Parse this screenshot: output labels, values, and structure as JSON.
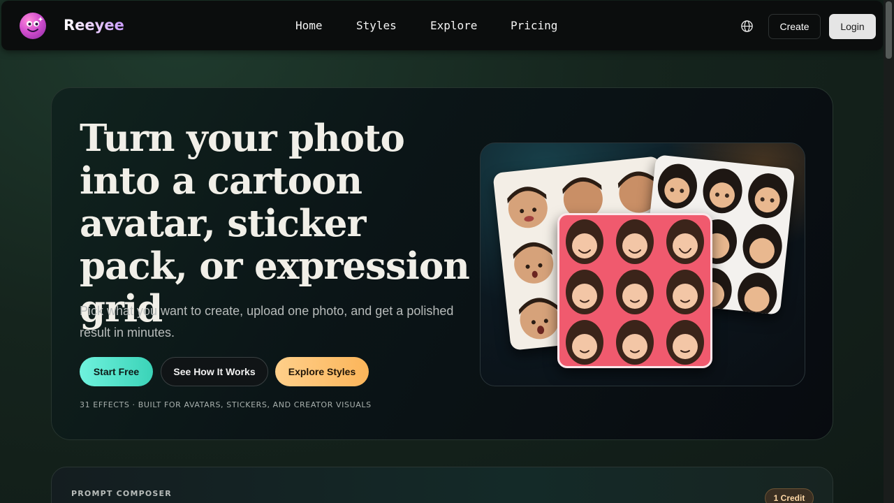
{
  "brand": {
    "name": "Reeyee"
  },
  "nav": {
    "links": [
      "Home",
      "Styles",
      "Explore",
      "Pricing"
    ],
    "create_label": "Create",
    "login_label": "Login"
  },
  "hero": {
    "title": "Turn your photo into a cartoon avatar, sticker pack, or expression grid",
    "subtitle": "Pick what you want to create, upload one photo, and get a polished result in minutes.",
    "buttons": {
      "start": "Start Free",
      "how": "See How It Works",
      "explore": "Explore Styles"
    },
    "meta": "31 EFFECTS · BUILT FOR AVATARS, STICKERS, AND CREATOR VISUALS"
  },
  "composer": {
    "label": "PROMPT COMPOSER",
    "credit": "1 Credit"
  },
  "colors": {
    "accent_teal": "#3bd3b8",
    "accent_orange": "#fbb55a",
    "sticker_pink": "#f05a6e"
  },
  "icons": {
    "logo": "smiley-logo-icon",
    "language": "globe-icon"
  }
}
